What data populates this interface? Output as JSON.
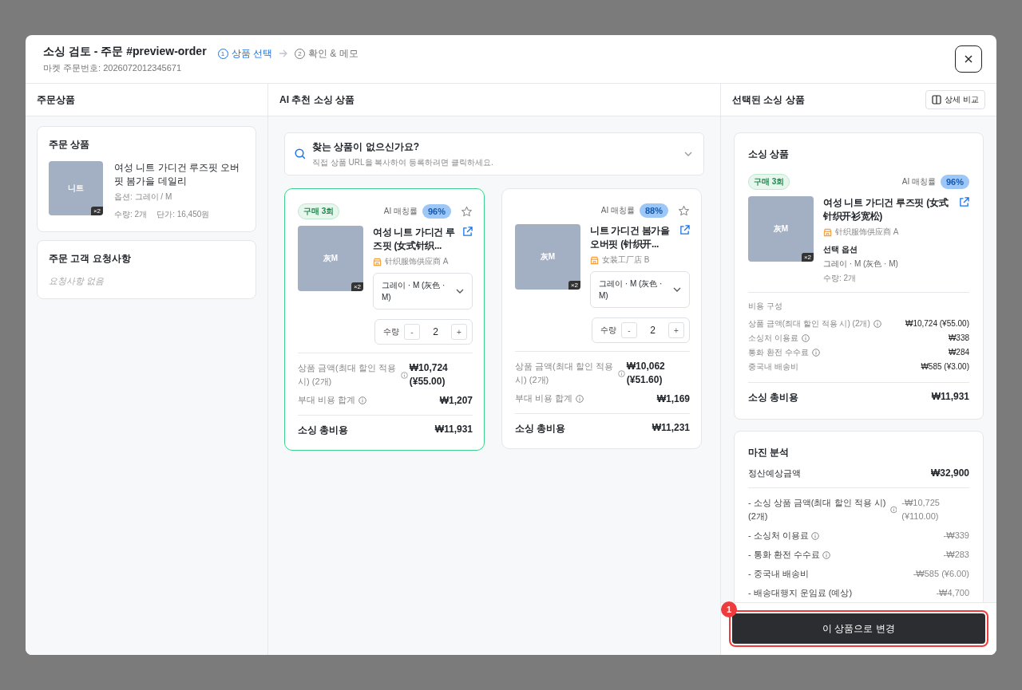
{
  "modal": {
    "title": "소싱 검토 - 주문 #preview-order",
    "subtitle": "마켓 주문번호: 2026072012345671",
    "steps": [
      {
        "number": "1",
        "label": "상품 선택",
        "selected": true
      },
      {
        "number": "2",
        "label": "확인 & 메모",
        "selected": false
      }
    ]
  },
  "order_column": {
    "header": "주문상품",
    "order_card": {
      "title": "주문 상품",
      "thumb_label": "니트",
      "thumb_qty": "×2",
      "name": "여성 니트 가디건 루즈핏 오버핏 봄가을 데일리",
      "option": "옵션: 그레이 / M",
      "quantity": "수량: 2개",
      "unit_price": "단가: 16,450원"
    },
    "request_card": {
      "title": "주문 고객 요청사항",
      "empty": "요청사항 없음"
    }
  },
  "ai_column": {
    "header": "AI 추천 소싱 상품",
    "search_prompt": {
      "title": "찾는 상품이 없으신가요?",
      "hint": "직접 상품 URL을 복사하여 등록하려면 클릭하세요.",
      "expanded": false
    },
    "candidates": [
      {
        "selected": true,
        "purchase_badge": "구매 3회",
        "match_label": "AI 매칭률",
        "match": "96%",
        "starred": false,
        "thumb_label": "灰M",
        "thumb_qty": "×2",
        "name": "여성 니트 가디건 루즈핏 (女式针织...",
        "supplier": "针织服饰供应商 A",
        "option": "그레이 · M (灰色 · M)",
        "qty_label": "수량",
        "minus": "-",
        "qty": "2",
        "plus": "+",
        "price_label": "상품 금액(최대 할인 적용 시) (2개)",
        "price": "₩10,724 (¥55.00)",
        "extra_label": "부대 비용 합계",
        "extra": "₩1,207",
        "total_label": "소싱 총비용",
        "total": "₩11,931"
      },
      {
        "selected": false,
        "match_label": "AI 매칭률",
        "match": "88%",
        "starred": false,
        "thumb_label": "灰M",
        "thumb_qty": "×2",
        "name": "니트 가디건 봄가을 오버핏 (针织开...",
        "supplier": "女装工厂店 B",
        "option": "그레이 · M (灰色 · M)",
        "qty_label": "수량",
        "minus": "-",
        "qty": "2",
        "plus": "+",
        "price_label": "상품 금액(최대 할인 적용 시) (2개)",
        "price": "₩10,062 (¥51.60)",
        "extra_label": "부대 비용 합계",
        "extra": "₩1,169",
        "total_label": "소싱 총비용",
        "total": "₩11,231"
      }
    ]
  },
  "selected_column": {
    "header": "선택된 소싱 상품",
    "compare_button": "상세 비교",
    "sourcing_card": {
      "title": "소싱 상품",
      "purchase_badge": "구매 3회",
      "match_label": "AI 매칭률",
      "match": "96%",
      "thumb_label": "灰M",
      "thumb_qty": "×2",
      "name": "여성 니트 가디건 루즈핏 (女式针织开衫宽松)",
      "supplier": "针织服饰供应商 A",
      "option_title": "선택 옵션",
      "option": "그레이 · M (灰色 · M)",
      "quantity": "수량: 2개",
      "cost_title": "비용 구성",
      "cost_rows": [
        {
          "label": "상품 금액(최대 할인 적용 시) (2개)",
          "info": true,
          "value": "₩10,724 (¥55.00)"
        },
        {
          "label": "소싱처 이용료",
          "info": true,
          "value": "₩338"
        },
        {
          "label": "통화 환전 수수료",
          "info": true,
          "value": "₩284"
        },
        {
          "label": "중국내 배송비",
          "info": false,
          "value": "₩585 (¥3.00)"
        }
      ],
      "total_label": "소싱 총비용",
      "total": "₩11,931"
    },
    "margin_card": {
      "title": "마진 분석",
      "settlement_label": "정산예상금액",
      "settlement": "₩32,900",
      "rows": [
        {
          "label": "- 소싱 상품 금액(최대 할인 적용 시) (2개)",
          "info": true,
          "value": "-₩10,725 (¥110.00)"
        },
        {
          "label": "- 소싱처 이용료",
          "info": true,
          "value": "-₩339"
        },
        {
          "label": "- 통화 환전 수수료",
          "info": true,
          "value": "-₩283"
        },
        {
          "label": "- 중국내 배송비",
          "info": false,
          "value": "-₩585 (¥6.00)"
        },
        {
          "label": "- 배송대행지 운임료 (예상)",
          "info": false,
          "value": "-₩4,700"
        }
      ]
    },
    "apply_button": "이 상품으로 변경",
    "annotation_marker": "1"
  }
}
